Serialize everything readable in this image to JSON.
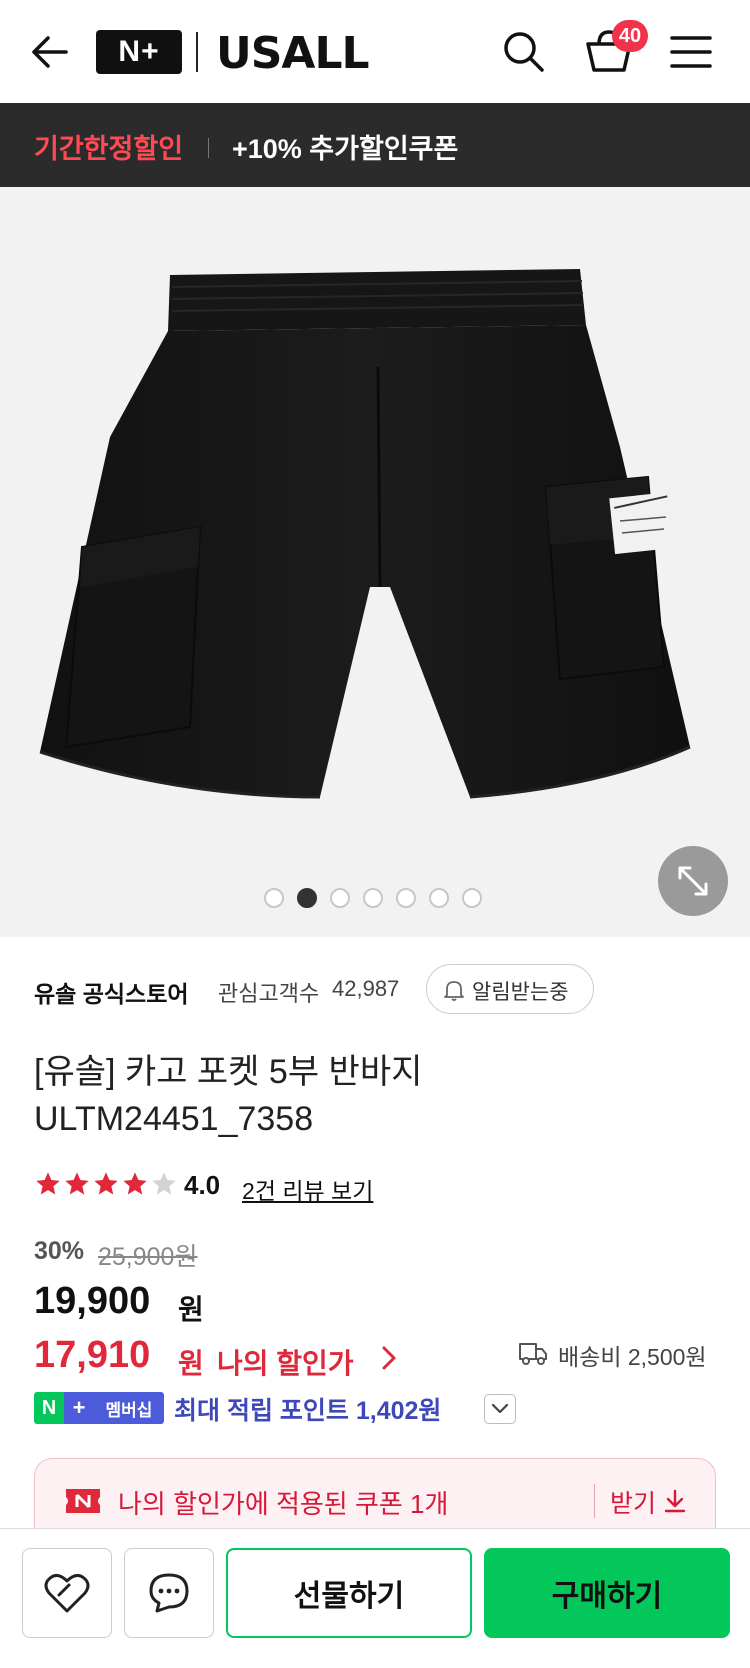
{
  "header": {
    "back_icon": "arrow-left-icon",
    "np_logo": "N+",
    "brand_logo": "USALL",
    "search_icon": "search-icon",
    "cart_icon": "cart-icon",
    "cart_count": "40",
    "menu_icon": "hamburger-menu-icon"
  },
  "promo": {
    "highlight": "기간한정할인",
    "text": "+10% 추가할인쿠폰"
  },
  "gallery": {
    "image": "black-cargo-shorts",
    "dots_total": 7,
    "dots_active_index": 1,
    "expand_icon": "expand-arrows-icon"
  },
  "store": {
    "name": "유솔 공식스토어",
    "follower_label": "관심고객수",
    "follower_count": "42,987",
    "alarm_label": "알림받는중"
  },
  "product": {
    "title": "[유솔] 카고 포켓 5부 반바지",
    "code": "ULTM24451_7358"
  },
  "rating": {
    "stars": 4,
    "max": 5,
    "value": "4.0",
    "review_link": "2건 리뷰 보기"
  },
  "price": {
    "discount_rate": "30%",
    "original": "25,900원",
    "sale": "19,900",
    "sale_unit": "원",
    "my_price": "17,910",
    "my_unit": "원",
    "my_label": "나의 할인가",
    "shipping": "배송비 2,500원"
  },
  "membership": {
    "badge_n": "N",
    "badge_plus": "+",
    "badge_label": "멤버십",
    "points_text": "최대 적립 포인트 1,402원"
  },
  "coupon": {
    "text": "나의 할인가에 적용된 쿠폰 1개",
    "get_label": "받기"
  },
  "actions": {
    "wish_icon": "heart-icon",
    "talk_icon": "chat-bubble-icon",
    "gift_label": "선물하기",
    "buy_label": "구매하기"
  },
  "colors": {
    "accent_green": "#03c75a",
    "price_red": "#e0283a",
    "membership_blue": "#4b5bd9",
    "promo_red": "#ff4a54"
  }
}
